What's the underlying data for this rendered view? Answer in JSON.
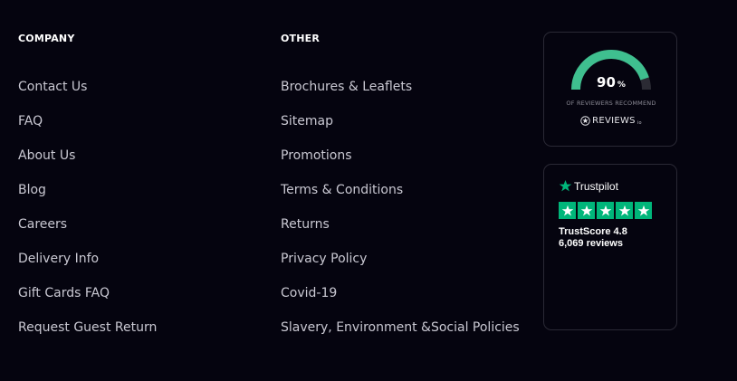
{
  "company": {
    "heading": "COMPANY",
    "links": [
      "Contact Us",
      "FAQ",
      "About Us",
      "Blog",
      "Careers",
      "Delivery Info",
      "Gift Cards FAQ",
      "Request Guest Return"
    ]
  },
  "other": {
    "heading": "OTHER",
    "links": [
      "Brochures & Leaflets",
      "Sitemap",
      "Promotions",
      "Terms & Conditions",
      "Returns",
      "Privacy Policy",
      "Covid-19",
      "Slavery, Environment &Social Policies"
    ]
  },
  "reviews_widget": {
    "percent": 90,
    "percent_value": "90",
    "percent_sign": "%",
    "caption": "OF REVIEWERS RECOMMEND",
    "logo_text": "REVIEWS",
    "logo_suffix": "io",
    "gauge_color": "#3fbf8f",
    "track_color": "#2b2b34"
  },
  "trustpilot_widget": {
    "brand": "Trustpilot",
    "score_label": "TrustScore 4.8",
    "reviews_label": "6,069 reviews",
    "stars": 5,
    "star_color": "#00b67a"
  },
  "colors": {
    "background": "#05040f",
    "card_border": "#2a2935",
    "link_text": "#c9c8d2",
    "heading_text": "#ffffff"
  }
}
